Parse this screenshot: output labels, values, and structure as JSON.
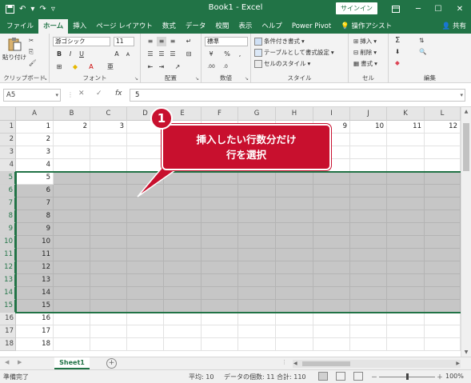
{
  "titlebar": {
    "save_icon": "save-icon",
    "undo_icon": "undo-icon",
    "redo_icon": "redo-icon",
    "qat_more_icon": "chevron-down-icon",
    "title": "Book1  -  Excel",
    "signin": "サインイン",
    "ribbon_display_icon": "ribbon-display-icon",
    "minimize_icon": "minimize-icon",
    "maximize_icon": "maximize-icon",
    "close_icon": "close-icon"
  },
  "tabs": [
    {
      "label": "ファイル"
    },
    {
      "label": "ホーム"
    },
    {
      "label": "挿入"
    },
    {
      "label": "ページ レイアウト"
    },
    {
      "label": "数式"
    },
    {
      "label": "データ"
    },
    {
      "label": "校閲"
    },
    {
      "label": "表示"
    },
    {
      "label": "ヘルプ"
    },
    {
      "label": "Power Pivot"
    },
    {
      "label": "操作アシスト"
    }
  ],
  "share": "共有",
  "ribbon": {
    "clipboard": {
      "label": "クリップボード",
      "paste": "貼り付け"
    },
    "font": {
      "label": "フォント",
      "name": "游ゴシック",
      "size": "11",
      "bold": "B",
      "italic": "I",
      "underline": "U",
      "grow": "A",
      "shrink": "A"
    },
    "alignment": {
      "label": "配置"
    },
    "number": {
      "label": "数値",
      "format": "標準",
      "percent": "%",
      "comma": ","
    },
    "styles": {
      "label": "スタイル",
      "conditional": "条件付き書式",
      "table": "テーブルとして書式設定",
      "cell": "セルのスタイル"
    },
    "cells": {
      "label": "セル",
      "insert": "挿入",
      "delete": "削除",
      "format": "書式"
    },
    "editing": {
      "label": "編集",
      "sum": "Σ"
    }
  },
  "formula_bar": {
    "name_box": "A5",
    "fx": "fx",
    "cancel": "✕",
    "enter": "✓",
    "value": "5"
  },
  "grid": {
    "columns": [
      "A",
      "B",
      "C",
      "D",
      "E",
      "F",
      "G",
      "H",
      "I",
      "J",
      "K",
      "L"
    ],
    "rows": [
      "1",
      "2",
      "3",
      "4",
      "5",
      "6",
      "7",
      "8",
      "9",
      "10",
      "11",
      "12",
      "13",
      "14",
      "15",
      "16",
      "17",
      "18"
    ],
    "row1_values": [
      "1",
      "2",
      "3",
      "",
      "",
      "",
      "",
      "",
      "9",
      "10",
      "11",
      "12"
    ],
    "colA_values": [
      "1",
      "2",
      "3",
      "4",
      "5",
      "6",
      "7",
      "8",
      "9",
      "10",
      "11",
      "12",
      "13",
      "14",
      "15",
      "16",
      "17",
      "18"
    ],
    "selected_rows": "5-15"
  },
  "callout": {
    "number": "1",
    "line1": "挿入したい行数分だけ",
    "line2": "行を選択"
  },
  "sheetbar": {
    "tab": "Sheet1",
    "add": "+"
  },
  "statusbar": {
    "mode": "準備完了",
    "average": "平均: 10",
    "count": "データの個数: 11",
    "sum": "合計: 110",
    "zoom": "100%"
  },
  "colors": {
    "accent": "#217346",
    "callout": "#c8102e",
    "selection": "#c6c6c6"
  }
}
